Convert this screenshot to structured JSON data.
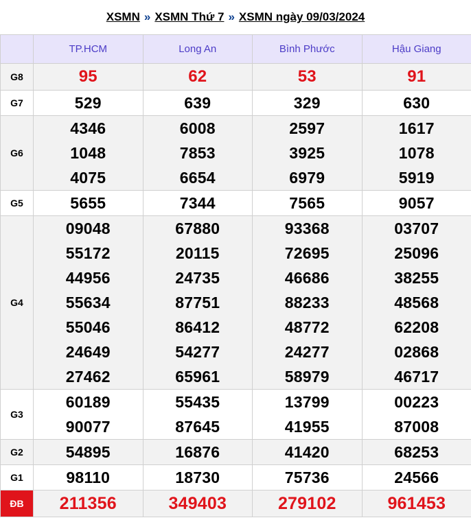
{
  "breadcrumb": {
    "link1": "XSMN",
    "sep1": "»",
    "link2": "XSMN Thứ 7",
    "sep2": "»",
    "link3": "XSMN ngày 09/03/2024"
  },
  "provinces": [
    "TP.HCM",
    "Long An",
    "Bình Phước",
    "Hậu Giang"
  ],
  "prizes": [
    {
      "label": "G8",
      "values": [
        [
          "95"
        ],
        [
          "62"
        ],
        [
          "53"
        ],
        [
          "91"
        ]
      ]
    },
    {
      "label": "G7",
      "values": [
        [
          "529"
        ],
        [
          "639"
        ],
        [
          "329"
        ],
        [
          "630"
        ]
      ]
    },
    {
      "label": "G6",
      "values": [
        [
          "4346",
          "1048",
          "4075"
        ],
        [
          "6008",
          "7853",
          "6654"
        ],
        [
          "2597",
          "3925",
          "6979"
        ],
        [
          "1617",
          "1078",
          "5919"
        ]
      ]
    },
    {
      "label": "G5",
      "values": [
        [
          "5655"
        ],
        [
          "7344"
        ],
        [
          "7565"
        ],
        [
          "9057"
        ]
      ]
    },
    {
      "label": "G4",
      "values": [
        [
          "09048",
          "55172",
          "44956",
          "55634",
          "55046",
          "24649",
          "27462"
        ],
        [
          "67880",
          "20115",
          "24735",
          "87751",
          "86412",
          "54277",
          "65961"
        ],
        [
          "93368",
          "72695",
          "46686",
          "88233",
          "48772",
          "24277",
          "58979"
        ],
        [
          "03707",
          "25096",
          "38255",
          "48568",
          "62208",
          "02868",
          "46717"
        ]
      ]
    },
    {
      "label": "G3",
      "values": [
        [
          "60189",
          "90077"
        ],
        [
          "55435",
          "87645"
        ],
        [
          "13799",
          "41955"
        ],
        [
          "00223",
          "87008"
        ]
      ]
    },
    {
      "label": "G2",
      "values": [
        [
          "54895"
        ],
        [
          "16876"
        ],
        [
          "41420"
        ],
        [
          "68253"
        ]
      ]
    },
    {
      "label": "G1",
      "values": [
        [
          "98110"
        ],
        [
          "18730"
        ],
        [
          "75736"
        ],
        [
          "24566"
        ]
      ]
    },
    {
      "label": "ĐB",
      "values": [
        [
          "211356"
        ],
        [
          "349403"
        ],
        [
          "279102"
        ],
        [
          "961453"
        ]
      ]
    }
  ],
  "colors": {
    "accent_red": "#e0141b",
    "header_bg": "#e8e4fb",
    "header_text": "#4c3cc7",
    "row_alt": "#f2f2f2"
  }
}
